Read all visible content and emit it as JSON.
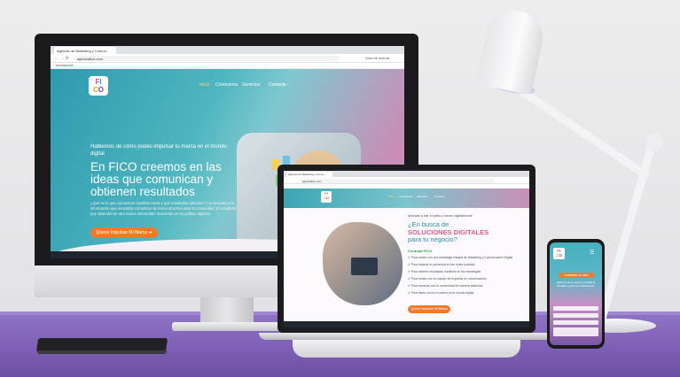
{
  "monitor": {
    "tab_title": "Agencia de Marketing y Comun...",
    "url": "agenciafico.com",
    "bookmarks": "Aplicaciones",
    "reading_list": "Lista de lectura",
    "nav": [
      "Inicio",
      "Conócenos",
      "Servicios",
      "Contacto"
    ],
    "hero_kicker": "Hablemos de cómo podés impulsar tu marca en el mundo digital",
    "hero_title": "En FICO creemos en las ideas que comunican y obtienen resultados",
    "hero_body": "¿Qué es lo que comunican nuestras ideas y qué resultados obtienen? Comunicamos tu información que necesitás comunicar de forma atractiva para tu comunidad. El resultado que obtendrá de una marca memorable focalizada en su público objetivo.",
    "cta": "Quiero Impulsar Mi Marca  ➜"
  },
  "laptop": {
    "tab_title": "Agencia de Marketing y Comu...",
    "url": "agenciafico.com",
    "nav": [
      "Inicio",
      "Conócenos",
      "Servicios",
      "Contacto"
    ],
    "kicker": "Animate a dar el salto y crecer digitalmente",
    "headline_1": "¿En busca de",
    "headline_2": "SOLUCIONES DIGITALES",
    "headline_3": "para tu negocio?",
    "list_title": "Contratá FICO",
    "checks": [
      "Para contar con una estrategia integral de Marketing y Comunicación Digital",
      "Para mejorar tu presencia en las redes sociales",
      "Para obtener resultados medibles en tus estrategias",
      "Para contar con un equipo de expertos en comunicación",
      "Para conectar con tu comunidad de manera auténtica",
      "Para hacer crecer tu marca en el mundo digital"
    ],
    "cta": "Quiero Impulsar Mi Marca"
  },
  "phone": {
    "cta_title": "Contanos tu idea",
    "text": "Hablemos de tu negocio. Completá el formulario y pronto te contactaremos."
  },
  "brand": {
    "letters": [
      "F",
      "I",
      "C",
      "O"
    ]
  }
}
